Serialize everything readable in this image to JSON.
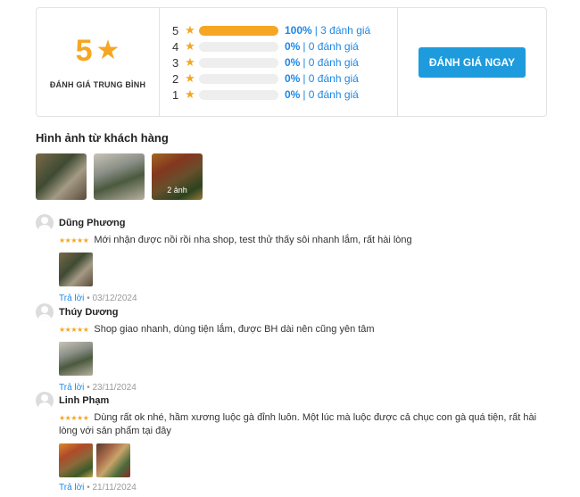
{
  "summary": {
    "average": "5",
    "average_label": "ĐÁNH GIÁ TRUNG BÌNH",
    "star_color": "#f5a623",
    "breakdown": [
      {
        "stars": "5",
        "fill": 1.0,
        "percent": "100%",
        "count_text": "| 3 đánh giá"
      },
      {
        "stars": "4",
        "fill": 0.0,
        "percent": "0%",
        "count_text": "| 0 đánh giá"
      },
      {
        "stars": "3",
        "fill": 0.0,
        "percent": "0%",
        "count_text": "| 0 đánh giá"
      },
      {
        "stars": "2",
        "fill": 0.0,
        "percent": "0%",
        "count_text": "| 0 đánh giá"
      },
      {
        "stars": "1",
        "fill": 0.0,
        "percent": "0%",
        "count_text": "| 0 đánh giá"
      }
    ],
    "cta_label": "ĐÁNH GIÁ NGAY"
  },
  "customer_images": {
    "title": "Hình ảnh từ khách hàng",
    "more_label": "2 ảnh"
  },
  "reviews": [
    {
      "name": "Dũng Phương",
      "rating": 5,
      "text": "Mới nhận được nồi rồi nha shop, test thử thấy sôi nhanh lắm, rất hài lòng",
      "reply_label": "Trả lời",
      "separator": "•",
      "date": "03/12/2024"
    },
    {
      "name": "Thúy Dương",
      "rating": 5,
      "text": "Shop giao nhanh, dùng tiện lắm, được BH dài nên cũng yên tâm",
      "reply_label": "Trả lời",
      "separator": "•",
      "date": "23/11/2024"
    },
    {
      "name": "Linh Phạm",
      "rating": 5,
      "text": "Dùng rất ok nhé, hầm xương luộc gà đỉnh luôn. Một lúc mà luộc được cả chục con gà quá tiện, rất hài lòng với sản phẩm tại đây",
      "reply_label": "Trả lời",
      "separator": "•",
      "date": "21/11/2024"
    }
  ],
  "icons": {
    "star": "★",
    "avatar": "user-avatar-icon"
  },
  "stars_text": "★★★★★"
}
